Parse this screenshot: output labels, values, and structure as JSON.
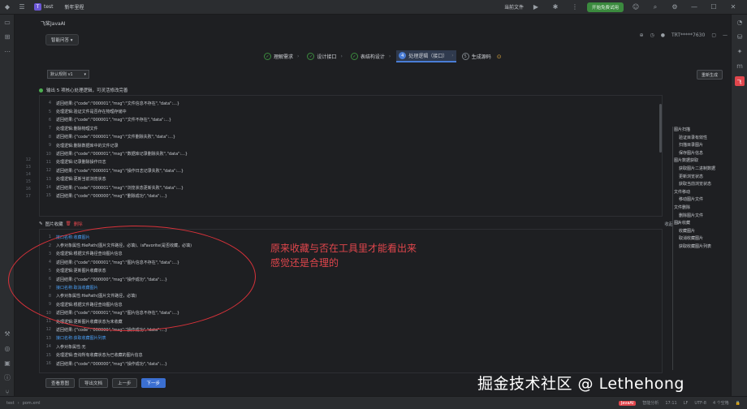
{
  "titlebar": {
    "project_badge": "T",
    "project_name": "test",
    "branch": "新年里程",
    "current_file": "当前文件",
    "run_label": "开始免费试用"
  },
  "header": {
    "tab_title": "飞桨JavaAI",
    "mode_label": "智能问答",
    "user_id": "TRT*****7630"
  },
  "steps": [
    {
      "label": "理解需求",
      "state": "done"
    },
    {
      "label": "设计接口",
      "state": "done"
    },
    {
      "label": "表结构设计",
      "state": "done"
    },
    {
      "label": "处理逻辑（接口）",
      "state": "active",
      "num": "4"
    },
    {
      "label": "生成源码",
      "state": "pending",
      "num": "5"
    }
  ],
  "controls": {
    "version_select": "默认规则 v1",
    "regen_label": "重新生成"
  },
  "status": {
    "text": "输出 5 项核心处理逻辑，可灵活修改完善"
  },
  "panel1": {
    "lines": [
      {
        "n": "4",
        "t": "返回结果:{\"code\":\"000001\",\"msg\":\"文件信息不存在\",\"data\":...}"
      },
      {
        "n": "5",
        "t": "处理逻辑:验证文件是否存在物理存储中"
      },
      {
        "n": "6",
        "t": "返回结果:{\"code\":\"000001\",\"msg\":\"文件不存在\",\"data\":...}"
      },
      {
        "n": "7",
        "t": "处理逻辑:删除物理文件"
      },
      {
        "n": "8",
        "t": "返回结果:{\"code\":\"000001\",\"msg\":\"文件删除失败\",\"data\":...}"
      },
      {
        "n": "9",
        "t": "处理逻辑:删除数据库中的文件记录"
      },
      {
        "n": "10",
        "t": "返回结果:{\"code\":\"000001\",\"msg\":\"数据库记录删除失败\",\"data\":...}"
      },
      {
        "n": "11",
        "t": "处理逻辑:记录删除操作日志"
      },
      {
        "n": "12",
        "t": "返回结果:{\"code\":\"000001\",\"msg\":\"操作日志记录失败\",\"data\":...}"
      },
      {
        "n": "13",
        "t": "处理逻辑:更新当前浏览状态"
      },
      {
        "n": "14",
        "t": "返回结果:{\"code\":\"000001\",\"msg\":\"浏览状态更新失败\",\"data\":...}"
      },
      {
        "n": "15",
        "t": "返回结果:{\"code\":\"000000\",\"msg\":\"删除成功\",\"data\":...}"
      }
    ]
  },
  "toolrow": {
    "title": "图片收藏",
    "delete_label": "删除",
    "fold_label": "收起"
  },
  "panel2": {
    "lines": [
      {
        "n": "1",
        "t": "接口名称:收藏图片",
        "blue": true
      },
      {
        "n": "2",
        "t": "入参对象属性:filePath(图片文件路径，必填)、isFavorite(是否收藏，必填)"
      },
      {
        "n": "3",
        "t": "处理逻辑:根据文件路径查询图片信息"
      },
      {
        "n": "4",
        "t": "返回结果:{\"code\":\"000001\",\"msg\":\"图片信息不存在\",\"data\":...}"
      },
      {
        "n": "5",
        "t": "处理逻辑:更新图片收藏状态"
      },
      {
        "n": "6",
        "t": "返回结果:{\"code\":\"000000\",\"msg\":\"操作成功\",\"data\":...}"
      },
      {
        "n": "7",
        "t": "接口名称:取消收藏图片",
        "blue": true
      },
      {
        "n": "8",
        "t": "入参对象属性:filePath(图片文件路径，必填)"
      },
      {
        "n": "9",
        "t": "处理逻辑:根据文件路径查询图片信息"
      },
      {
        "n": "10",
        "t": "返回结果:{\"code\":\"000001\",\"msg\":\"图片信息不存在\",\"data\":...}"
      },
      {
        "n": "11",
        "t": "处理逻辑:更新图片收藏状态为未收藏"
      },
      {
        "n": "12",
        "t": "返回结果:{\"code\":\"000000\",\"msg\":\"操作成功\",\"data\":...}"
      },
      {
        "n": "13",
        "t": "接口名称:获取收藏图片列表",
        "blue": true
      },
      {
        "n": "14",
        "t": "入参对象属性:无"
      },
      {
        "n": "15",
        "t": "处理逻辑:查询所有收藏状态为已收藏的图片信息"
      },
      {
        "n": "16",
        "t": "返回结果:{\"code\":\"000000\",\"msg\":\"操作成功\",\"data\":...}"
      }
    ]
  },
  "outline": [
    {
      "t": "图片扫描",
      "lvl": 1
    },
    {
      "t": "验证目录有效性",
      "lvl": 2
    },
    {
      "t": "扫描目录图片",
      "lvl": 2
    },
    {
      "t": "保存图片信息",
      "lvl": 2
    },
    {
      "t": "图片数据获取",
      "lvl": 1
    },
    {
      "t": "获取图片二进制数据",
      "lvl": 2
    },
    {
      "t": "更新浏览状态",
      "lvl": 2
    },
    {
      "t": "获取当前浏览状态",
      "lvl": 2
    },
    {
      "t": "文件移动",
      "lvl": 1
    },
    {
      "t": "移动图片文件",
      "lvl": 2
    },
    {
      "t": "文件删除",
      "lvl": 1
    },
    {
      "t": "删除图片文件",
      "lvl": 2
    },
    {
      "t": "图片收藏",
      "lvl": 1
    },
    {
      "t": "收藏图片",
      "lvl": 2
    },
    {
      "t": "取消收藏图片",
      "lvl": 2
    },
    {
      "t": "获取收藏图片列表",
      "lvl": 2
    }
  ],
  "buttons": {
    "view_details": "查看意图",
    "export_doc": "导出文档",
    "prev": "上一步",
    "next": "下一步"
  },
  "annotation": {
    "line1": "原来收藏与否在工具里才能看出来",
    "line2": "感觉还是合理的"
  },
  "watermark": "掘金技术社区 @ Lethehong",
  "statusbar": {
    "left_a": "test",
    "left_b": "pom.xml",
    "r1": "JavaAI",
    "r2": "智能分析",
    "r3": "17:11",
    "r4": "LF",
    "r5": "UTF-8",
    "r6": "4 个空格"
  }
}
